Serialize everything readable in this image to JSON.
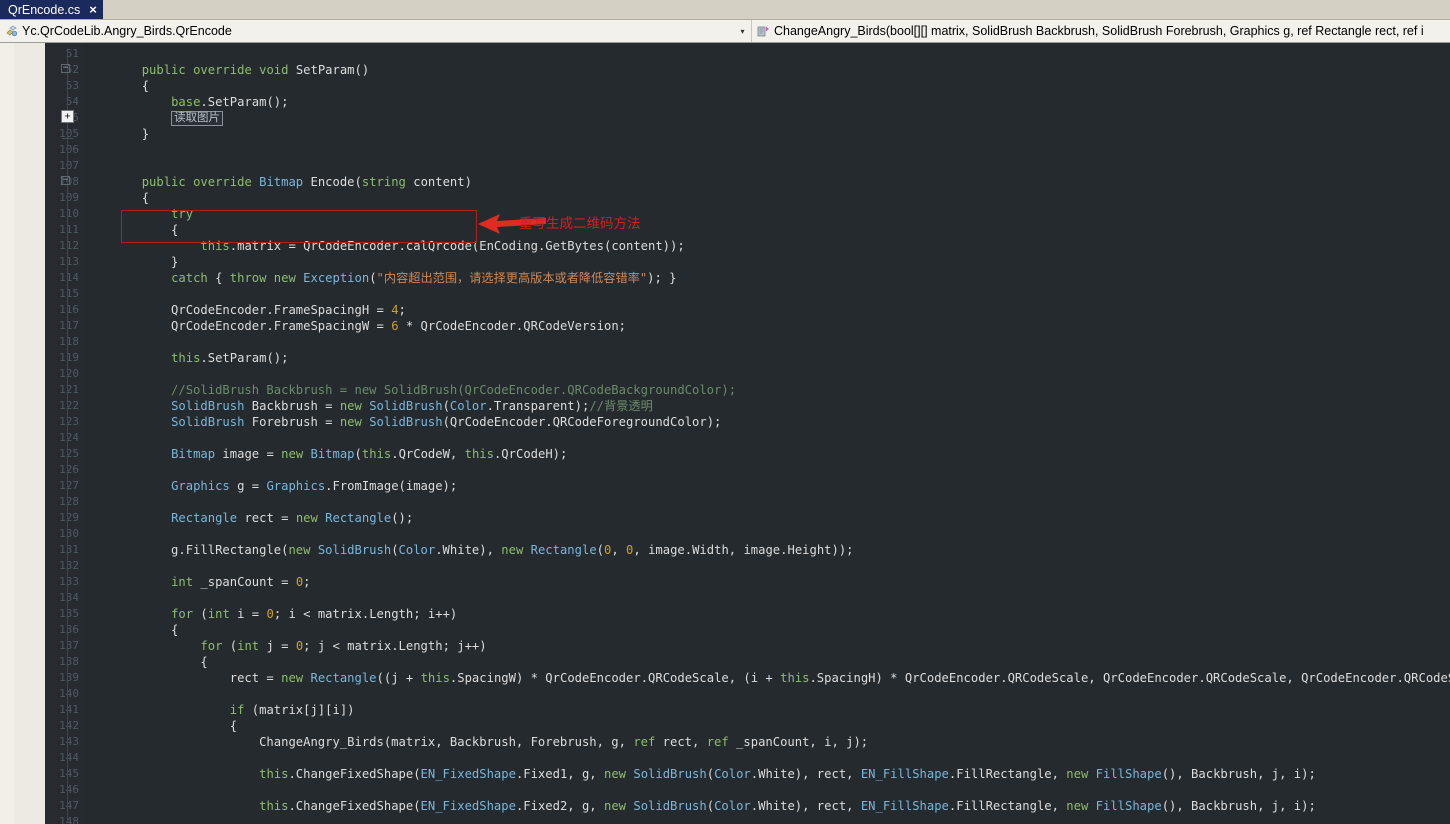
{
  "tab": {
    "label": "QrEncode.cs",
    "close_icon": "×"
  },
  "navbar": {
    "class_combo": {
      "icon": "class-icon",
      "text": "Yc.QrCodeLib.Angry_Birds.QrEncode",
      "arrow": "▾"
    },
    "member_combo": {
      "icon": "method-icon",
      "text": "ChangeAngry_Birds(bool[][] matrix, SolidBrush Backbrush, SolidBrush Forebrush, Graphics g, ref Rectangle rect, ref i",
      "arrow": "▾"
    }
  },
  "annotation": {
    "text": "重写生成二维码方法",
    "color": "#d22020",
    "box_color": "#b02020"
  },
  "collapsed_region": {
    "label": "读取图片"
  },
  "editor": {
    "background": "#252a2e",
    "gutter_background": "#272b30",
    "linenumber_color": "#4e5b62",
    "colors": {
      "keyword": "#8fbc70",
      "type": "#7ab6d9",
      "string": "#c98a5d",
      "number": "#c9a227",
      "comment": "#6c8a6c",
      "plain": "#dcdcdc"
    },
    "line_numbers": [
      "51",
      "52",
      "53",
      "54",
      "55",
      "105",
      "106",
      "107",
      "108",
      "109",
      "110",
      "111",
      "112",
      "113",
      "114",
      "115",
      "116",
      "117",
      "118",
      "119",
      "120",
      "121",
      "122",
      "123",
      "124",
      "125",
      "126",
      "127",
      "128",
      "129",
      "130",
      "131",
      "132",
      "133",
      "134",
      "135",
      "136",
      "137",
      "138",
      "139",
      "140",
      "141",
      "142",
      "143",
      "144",
      "145",
      "146",
      "147",
      "148"
    ],
    "fold_markers": [
      {
        "line": "52",
        "glyph": "-"
      },
      {
        "line": "55",
        "glyph": "+"
      },
      {
        "line": "108",
        "glyph": "-"
      }
    ],
    "code": [
      {
        "n": "51",
        "tokens": []
      },
      {
        "n": "52",
        "tokens": [
          {
            "t": "        ",
            "c": "pln"
          },
          {
            "t": "public",
            "c": "kw"
          },
          {
            "t": " ",
            "c": "pln"
          },
          {
            "t": "override",
            "c": "kw"
          },
          {
            "t": " ",
            "c": "pln"
          },
          {
            "t": "void",
            "c": "kw"
          },
          {
            "t": " SetParam()",
            "c": "pln"
          }
        ]
      },
      {
        "n": "53",
        "tokens": [
          {
            "t": "        {",
            "c": "pln"
          }
        ]
      },
      {
        "n": "54",
        "tokens": [
          {
            "t": "            ",
            "c": "pln"
          },
          {
            "t": "base",
            "c": "kw"
          },
          {
            "t": ".SetParam();",
            "c": "pln"
          }
        ]
      },
      {
        "n": "55",
        "tokens": [
          {
            "t": "            ",
            "c": "pln"
          },
          {
            "t": "读取图片",
            "c": "collapsed"
          }
        ]
      },
      {
        "n": "105",
        "tokens": [
          {
            "t": "        }",
            "c": "pln"
          }
        ]
      },
      {
        "n": "106",
        "tokens": []
      },
      {
        "n": "107",
        "tokens": []
      },
      {
        "n": "108",
        "tokens": [
          {
            "t": "        ",
            "c": "pln"
          },
          {
            "t": "public",
            "c": "kw"
          },
          {
            "t": " ",
            "c": "pln"
          },
          {
            "t": "override",
            "c": "kw"
          },
          {
            "t": " ",
            "c": "pln"
          },
          {
            "t": "Bitmap",
            "c": "typ"
          },
          {
            "t": " Encode(",
            "c": "pln"
          },
          {
            "t": "string",
            "c": "kw"
          },
          {
            "t": " content)",
            "c": "pln"
          }
        ]
      },
      {
        "n": "109",
        "tokens": [
          {
            "t": "        {",
            "c": "pln"
          }
        ]
      },
      {
        "n": "110",
        "tokens": [
          {
            "t": "            ",
            "c": "pln"
          },
          {
            "t": "try",
            "c": "kw"
          }
        ]
      },
      {
        "n": "111",
        "tokens": [
          {
            "t": "            {",
            "c": "pln"
          }
        ]
      },
      {
        "n": "112",
        "tokens": [
          {
            "t": "                ",
            "c": "pln"
          },
          {
            "t": "this",
            "c": "kw"
          },
          {
            "t": ".matrix = QrCodeEncoder.calQrcode(EnCoding.GetBytes(content));",
            "c": "pln"
          }
        ]
      },
      {
        "n": "113",
        "tokens": [
          {
            "t": "            }",
            "c": "pln"
          }
        ]
      },
      {
        "n": "114",
        "tokens": [
          {
            "t": "            ",
            "c": "pln"
          },
          {
            "t": "catch",
            "c": "kw"
          },
          {
            "t": " { ",
            "c": "pln"
          },
          {
            "t": "throw",
            "c": "kw"
          },
          {
            "t": " ",
            "c": "pln"
          },
          {
            "t": "new",
            "c": "kw"
          },
          {
            "t": " ",
            "c": "pln"
          },
          {
            "t": "Exception",
            "c": "typ"
          },
          {
            "t": "(",
            "c": "pln"
          },
          {
            "t": "\"内容超出范围，请选择更高版本或者降低容错率\"",
            "c": "str"
          },
          {
            "t": "); }",
            "c": "pln"
          }
        ]
      },
      {
        "n": "115",
        "tokens": []
      },
      {
        "n": "116",
        "tokens": [
          {
            "t": "            QrCodeEncoder.FrameSpacingH = ",
            "c": "pln"
          },
          {
            "t": "4",
            "c": "num"
          },
          {
            "t": ";",
            "c": "pln"
          }
        ]
      },
      {
        "n": "117",
        "tokens": [
          {
            "t": "            QrCodeEncoder.FrameSpacingW = ",
            "c": "pln"
          },
          {
            "t": "6",
            "c": "num"
          },
          {
            "t": " * QrCodeEncoder.QRCodeVersion;",
            "c": "pln"
          }
        ]
      },
      {
        "n": "118",
        "tokens": []
      },
      {
        "n": "119",
        "tokens": [
          {
            "t": "            ",
            "c": "pln"
          },
          {
            "t": "this",
            "c": "kw"
          },
          {
            "t": ".SetParam();",
            "c": "pln"
          }
        ]
      },
      {
        "n": "120",
        "tokens": []
      },
      {
        "n": "121",
        "tokens": [
          {
            "t": "            //SolidBrush Backbrush = new SolidBrush(QrCodeEncoder.QRCodeBackgroundColor);",
            "c": "cmt"
          }
        ]
      },
      {
        "n": "122",
        "tokens": [
          {
            "t": "            ",
            "c": "pln"
          },
          {
            "t": "SolidBrush",
            "c": "typ"
          },
          {
            "t": " Backbrush = ",
            "c": "pln"
          },
          {
            "t": "new",
            "c": "kw"
          },
          {
            "t": " ",
            "c": "pln"
          },
          {
            "t": "SolidBrush",
            "c": "typ"
          },
          {
            "t": "(",
            "c": "pln"
          },
          {
            "t": "Color",
            "c": "typ"
          },
          {
            "t": ".Transparent);",
            "c": "pln"
          },
          {
            "t": "//背景透明",
            "c": "cmt"
          }
        ]
      },
      {
        "n": "123",
        "tokens": [
          {
            "t": "            ",
            "c": "pln"
          },
          {
            "t": "SolidBrush",
            "c": "typ"
          },
          {
            "t": " Forebrush = ",
            "c": "pln"
          },
          {
            "t": "new",
            "c": "kw"
          },
          {
            "t": " ",
            "c": "pln"
          },
          {
            "t": "SolidBrush",
            "c": "typ"
          },
          {
            "t": "(QrCodeEncoder.QRCodeForegroundColor);",
            "c": "pln"
          }
        ]
      },
      {
        "n": "124",
        "tokens": []
      },
      {
        "n": "125",
        "tokens": [
          {
            "t": "            ",
            "c": "pln"
          },
          {
            "t": "Bitmap",
            "c": "typ"
          },
          {
            "t": " image = ",
            "c": "pln"
          },
          {
            "t": "new",
            "c": "kw"
          },
          {
            "t": " ",
            "c": "pln"
          },
          {
            "t": "Bitmap",
            "c": "typ"
          },
          {
            "t": "(",
            "c": "pln"
          },
          {
            "t": "this",
            "c": "kw"
          },
          {
            "t": ".QrCodeW, ",
            "c": "pln"
          },
          {
            "t": "this",
            "c": "kw"
          },
          {
            "t": ".QrCodeH);",
            "c": "pln"
          }
        ]
      },
      {
        "n": "126",
        "tokens": []
      },
      {
        "n": "127",
        "tokens": [
          {
            "t": "            ",
            "c": "pln"
          },
          {
            "t": "Graphics",
            "c": "typ"
          },
          {
            "t": " g = ",
            "c": "pln"
          },
          {
            "t": "Graphics",
            "c": "typ"
          },
          {
            "t": ".FromImage(image);",
            "c": "pln"
          }
        ]
      },
      {
        "n": "128",
        "tokens": []
      },
      {
        "n": "129",
        "tokens": [
          {
            "t": "            ",
            "c": "pln"
          },
          {
            "t": "Rectangle",
            "c": "typ"
          },
          {
            "t": " rect = ",
            "c": "pln"
          },
          {
            "t": "new",
            "c": "kw"
          },
          {
            "t": " ",
            "c": "pln"
          },
          {
            "t": "Rectangle",
            "c": "typ"
          },
          {
            "t": "();",
            "c": "pln"
          }
        ]
      },
      {
        "n": "130",
        "tokens": []
      },
      {
        "n": "131",
        "tokens": [
          {
            "t": "            g.FillRectangle(",
            "c": "pln"
          },
          {
            "t": "new",
            "c": "kw"
          },
          {
            "t": " ",
            "c": "pln"
          },
          {
            "t": "SolidBrush",
            "c": "typ"
          },
          {
            "t": "(",
            "c": "pln"
          },
          {
            "t": "Color",
            "c": "typ"
          },
          {
            "t": ".White), ",
            "c": "pln"
          },
          {
            "t": "new",
            "c": "kw"
          },
          {
            "t": " ",
            "c": "pln"
          },
          {
            "t": "Rectangle",
            "c": "typ"
          },
          {
            "t": "(",
            "c": "pln"
          },
          {
            "t": "0",
            "c": "num"
          },
          {
            "t": ", ",
            "c": "pln"
          },
          {
            "t": "0",
            "c": "num"
          },
          {
            "t": ", image.Width, image.Height));",
            "c": "pln"
          }
        ]
      },
      {
        "n": "132",
        "tokens": []
      },
      {
        "n": "133",
        "tokens": [
          {
            "t": "            ",
            "c": "pln"
          },
          {
            "t": "int",
            "c": "kw"
          },
          {
            "t": " _spanCount = ",
            "c": "pln"
          },
          {
            "t": "0",
            "c": "num"
          },
          {
            "t": ";",
            "c": "pln"
          }
        ]
      },
      {
        "n": "134",
        "tokens": []
      },
      {
        "n": "135",
        "tokens": [
          {
            "t": "            ",
            "c": "pln"
          },
          {
            "t": "for",
            "c": "kw"
          },
          {
            "t": " (",
            "c": "pln"
          },
          {
            "t": "int",
            "c": "kw"
          },
          {
            "t": " i = ",
            "c": "pln"
          },
          {
            "t": "0",
            "c": "num"
          },
          {
            "t": "; i < matrix.Length; i++)",
            "c": "pln"
          }
        ]
      },
      {
        "n": "136",
        "tokens": [
          {
            "t": "            {",
            "c": "pln"
          }
        ]
      },
      {
        "n": "137",
        "tokens": [
          {
            "t": "                ",
            "c": "pln"
          },
          {
            "t": "for",
            "c": "kw"
          },
          {
            "t": " (",
            "c": "pln"
          },
          {
            "t": "int",
            "c": "kw"
          },
          {
            "t": " j = ",
            "c": "pln"
          },
          {
            "t": "0",
            "c": "num"
          },
          {
            "t": "; j < matrix.Length; j++)",
            "c": "pln"
          }
        ]
      },
      {
        "n": "138",
        "tokens": [
          {
            "t": "                {",
            "c": "pln"
          }
        ]
      },
      {
        "n": "139",
        "tokens": [
          {
            "t": "                    rect = ",
            "c": "pln"
          },
          {
            "t": "new",
            "c": "kw"
          },
          {
            "t": " ",
            "c": "pln"
          },
          {
            "t": "Rectangle",
            "c": "typ"
          },
          {
            "t": "((j + ",
            "c": "pln"
          },
          {
            "t": "this",
            "c": "kw"
          },
          {
            "t": ".SpacingW) * QrCodeEncoder.QRCodeScale, (i + ",
            "c": "pln"
          },
          {
            "t": "this",
            "c": "kw"
          },
          {
            "t": ".SpacingH) * QrCodeEncoder.QRCodeScale, QrCodeEncoder.QRCodeScale, QrCodeEncoder.QRCodeScale);",
            "c": "pln"
          }
        ]
      },
      {
        "n": "140",
        "tokens": []
      },
      {
        "n": "141",
        "tokens": [
          {
            "t": "                    ",
            "c": "pln"
          },
          {
            "t": "if",
            "c": "kw"
          },
          {
            "t": " (matrix[j][i])",
            "c": "pln"
          }
        ]
      },
      {
        "n": "142",
        "tokens": [
          {
            "t": "                    {",
            "c": "pln"
          }
        ]
      },
      {
        "n": "143",
        "tokens": [
          {
            "t": "                        ChangeAngry_Birds(matrix, Backbrush, Forebrush, g, ",
            "c": "pln"
          },
          {
            "t": "ref",
            "c": "kw"
          },
          {
            "t": " rect, ",
            "c": "pln"
          },
          {
            "t": "ref",
            "c": "kw"
          },
          {
            "t": " _spanCount, i, j);",
            "c": "pln"
          }
        ]
      },
      {
        "n": "144",
        "tokens": []
      },
      {
        "n": "145",
        "tokens": [
          {
            "t": "                        ",
            "c": "pln"
          },
          {
            "t": "this",
            "c": "kw"
          },
          {
            "t": ".ChangeFixedShape(",
            "c": "pln"
          },
          {
            "t": "EN_FixedShape",
            "c": "typ"
          },
          {
            "t": ".Fixed1, g, ",
            "c": "pln"
          },
          {
            "t": "new",
            "c": "kw"
          },
          {
            "t": " ",
            "c": "pln"
          },
          {
            "t": "SolidBrush",
            "c": "typ"
          },
          {
            "t": "(",
            "c": "pln"
          },
          {
            "t": "Color",
            "c": "typ"
          },
          {
            "t": ".White), rect, ",
            "c": "pln"
          },
          {
            "t": "EN_FillShape",
            "c": "typ"
          },
          {
            "t": ".FillRectangle, ",
            "c": "pln"
          },
          {
            "t": "new",
            "c": "kw"
          },
          {
            "t": " ",
            "c": "pln"
          },
          {
            "t": "FillShape",
            "c": "typ"
          },
          {
            "t": "(), Backbrush, j, i);",
            "c": "pln"
          }
        ]
      },
      {
        "n": "146",
        "tokens": []
      },
      {
        "n": "147",
        "tokens": [
          {
            "t": "                        ",
            "c": "pln"
          },
          {
            "t": "this",
            "c": "kw"
          },
          {
            "t": ".ChangeFixedShape(",
            "c": "pln"
          },
          {
            "t": "EN_FixedShape",
            "c": "typ"
          },
          {
            "t": ".Fixed2, g, ",
            "c": "pln"
          },
          {
            "t": "new",
            "c": "kw"
          },
          {
            "t": " ",
            "c": "pln"
          },
          {
            "t": "SolidBrush",
            "c": "typ"
          },
          {
            "t": "(",
            "c": "pln"
          },
          {
            "t": "Color",
            "c": "typ"
          },
          {
            "t": ".White), rect, ",
            "c": "pln"
          },
          {
            "t": "EN_FillShape",
            "c": "typ"
          },
          {
            "t": ".FillRectangle, ",
            "c": "pln"
          },
          {
            "t": "new",
            "c": "kw"
          },
          {
            "t": " ",
            "c": "pln"
          },
          {
            "t": "FillShape",
            "c": "typ"
          },
          {
            "t": "(), Backbrush, j, i);",
            "c": "pln"
          }
        ]
      },
      {
        "n": "148",
        "tokens": []
      }
    ]
  }
}
